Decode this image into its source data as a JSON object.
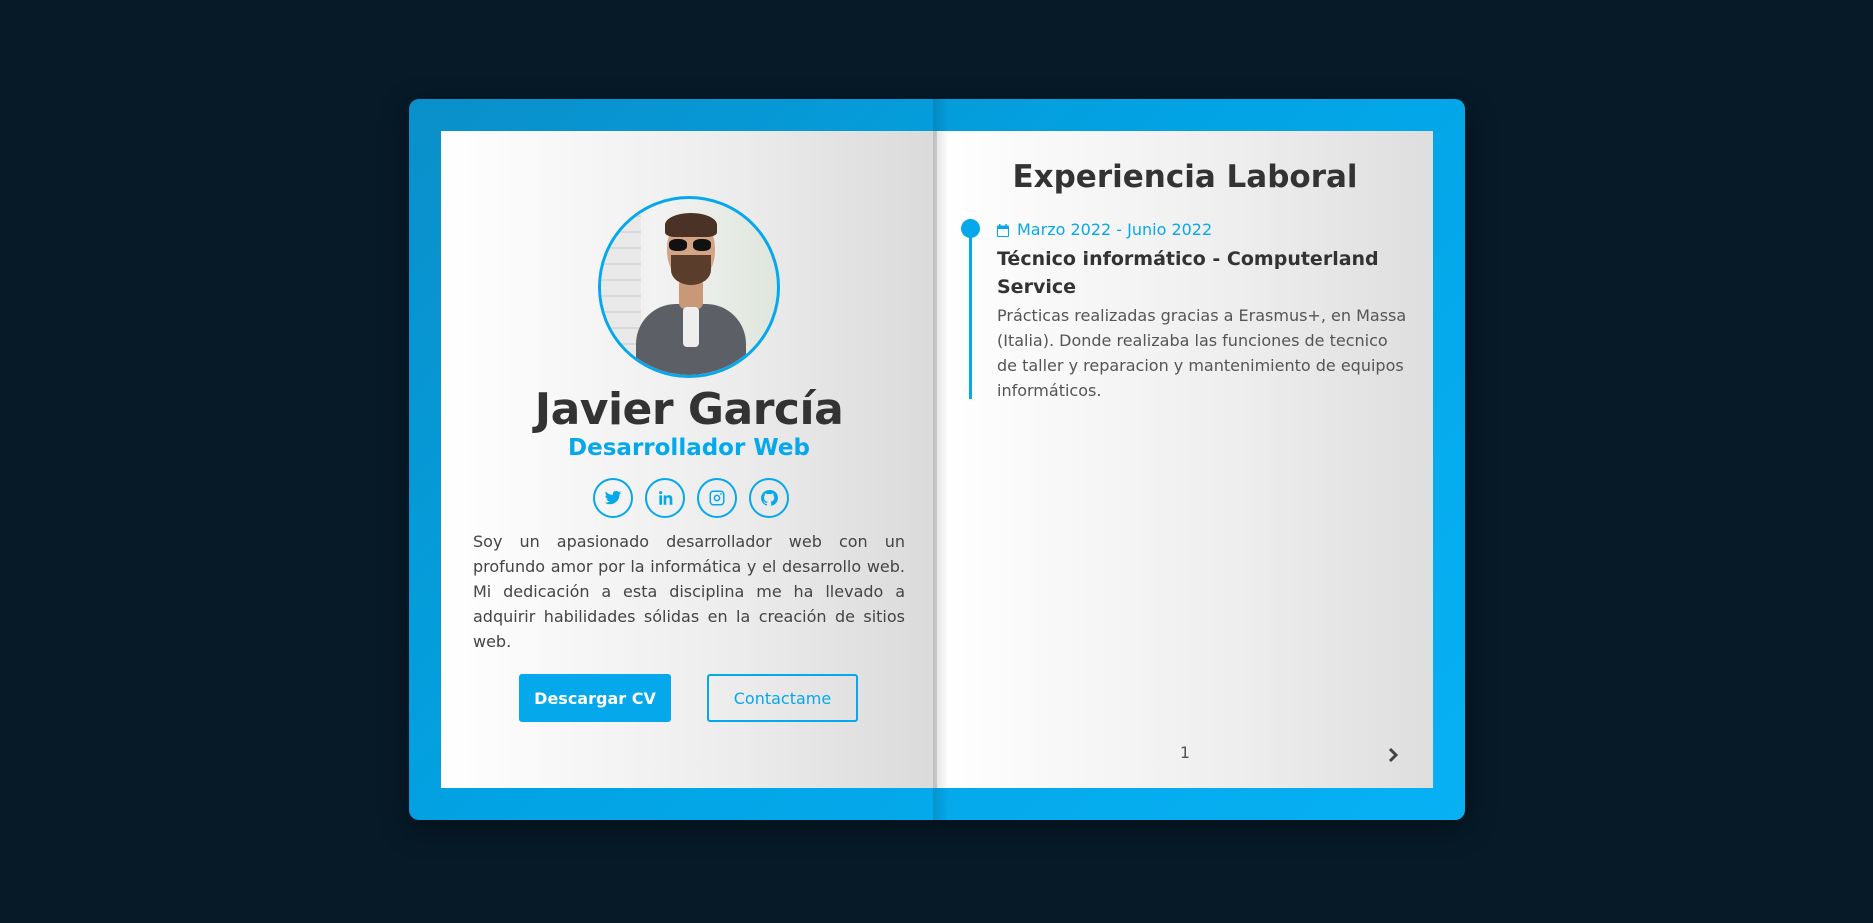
{
  "profile": {
    "name": "Javier García",
    "role": "Desarrollador Web",
    "bio": "Soy un apasionado desarrollador web con un profundo amor por la informática y el desarrollo web. Mi dedicación a esta disciplina me ha llevado a adquirir habilidades sólidas en la creación de sitios web."
  },
  "socials": [
    "twitter-icon",
    "linkedin-icon",
    "instagram-icon",
    "github-icon"
  ],
  "buttons": {
    "download": "Descargar CV",
    "contact": "Contactame"
  },
  "experience": {
    "title": "Experiencia Laboral",
    "items": [
      {
        "date": "Marzo 2022 - Junio 2022",
        "position": "Técnico informático - Computerland Service",
        "description": "Prácticas realizadas gracias a Erasmus+, en Massa (Italia). Donde realizaba las funciones de tecnico de taller y reparacion y mantenimiento de equipos informáticos."
      }
    ]
  },
  "pagination": {
    "page": "1"
  },
  "colors": {
    "accent": "#06a8ec",
    "background": "#061a28",
    "text": "#333333"
  }
}
